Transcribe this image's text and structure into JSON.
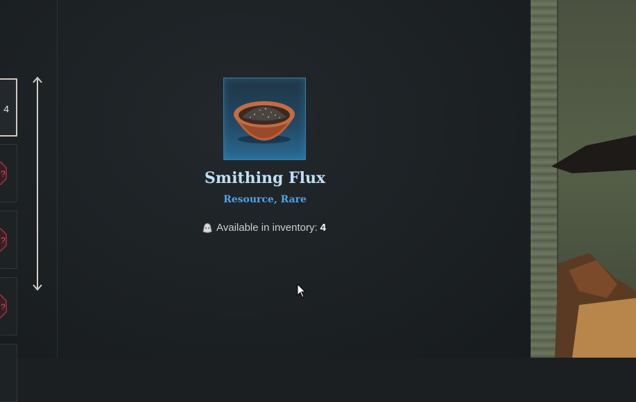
{
  "item": {
    "name": "Smithing Flux",
    "category": "Resource, Rare",
    "inventory_label": "Available in inventory:",
    "inventory_count": "4",
    "icon": "bowl-of-flux"
  },
  "list": {
    "selected_slot_count": "4",
    "slots": [
      {
        "selected": true
      },
      {
        "badge": "red-octagon"
      },
      {
        "badge": "red-octagon"
      },
      {
        "badge": "red-octagon"
      }
    ]
  },
  "colors": {
    "title": "#bfe0f5",
    "category": "#4fa3e8",
    "frame_border": "#3f7da8"
  }
}
